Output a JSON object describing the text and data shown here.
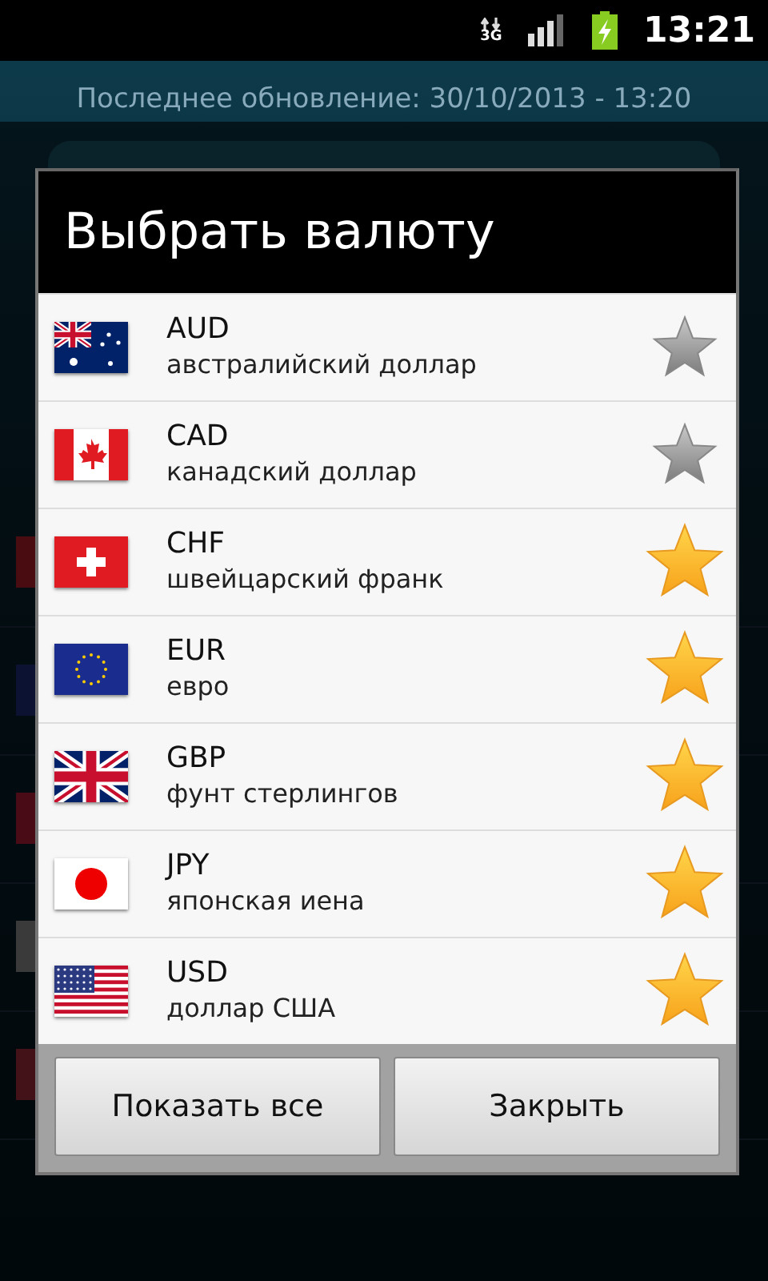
{
  "status_bar": {
    "network": "3G",
    "time": "13:21"
  },
  "background": {
    "last_update": "Последнее обновление: 30/10/2013 - 13:20"
  },
  "dialog": {
    "title": "Выбрать валюту",
    "currencies": [
      {
        "kind": "au",
        "code": "AUD",
        "name": "австралийский доллар",
        "starred": false
      },
      {
        "kind": "ca",
        "code": "CAD",
        "name": "канадский доллар",
        "starred": false
      },
      {
        "kind": "ch",
        "code": "CHF",
        "name": "швейцарский франк",
        "starred": true
      },
      {
        "kind": "eu",
        "code": "EUR",
        "name": "евро",
        "starred": true
      },
      {
        "kind": "gb",
        "code": "GBP",
        "name": "фунт стерлингов",
        "starred": true
      },
      {
        "kind": "jp",
        "code": "JPY",
        "name": "японская иена",
        "starred": true
      },
      {
        "kind": "us",
        "code": "USD",
        "name": "доллар США",
        "starred": true
      }
    ],
    "buttons": [
      "Показать все",
      "Закрыть"
    ]
  }
}
